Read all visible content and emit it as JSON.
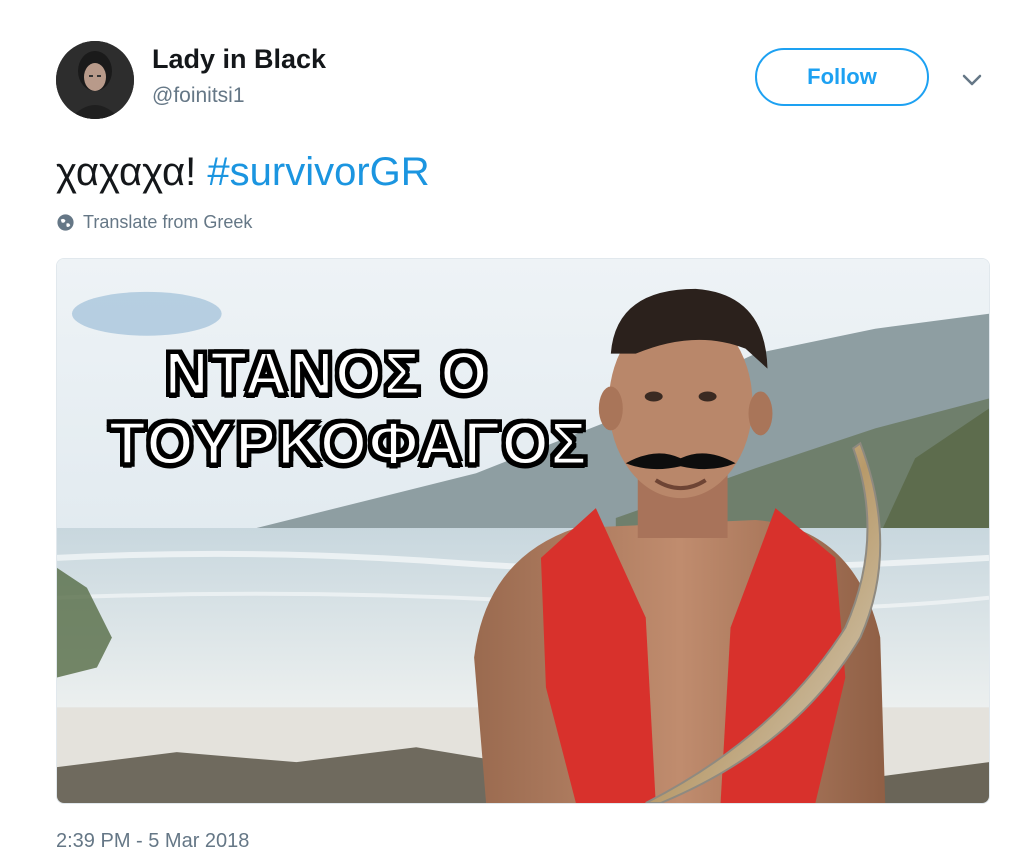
{
  "author": {
    "display_name": "Lady in Black",
    "handle": "@foinitsi1",
    "avatar_icon": "profile-avatar"
  },
  "actions": {
    "follow_label": "Follow",
    "more_icon": "chevron-down-icon"
  },
  "tweet": {
    "text": "χαχαχα! ",
    "hashtag": "#survivorGR",
    "translate_label": "Translate from Greek",
    "translate_icon": "globe-icon"
  },
  "media": {
    "caption_line1": "ΝΤΑΝΟΣ Ο",
    "caption_line2": "ΤΟΥΡΚΟΦΑΓΟΣ"
  },
  "timestamp": "2:39 PM - 5 Mar 2018",
  "colors": {
    "accent": "#1da1f2",
    "hashtag": "#1b95e0",
    "secondary_text": "#657786"
  }
}
